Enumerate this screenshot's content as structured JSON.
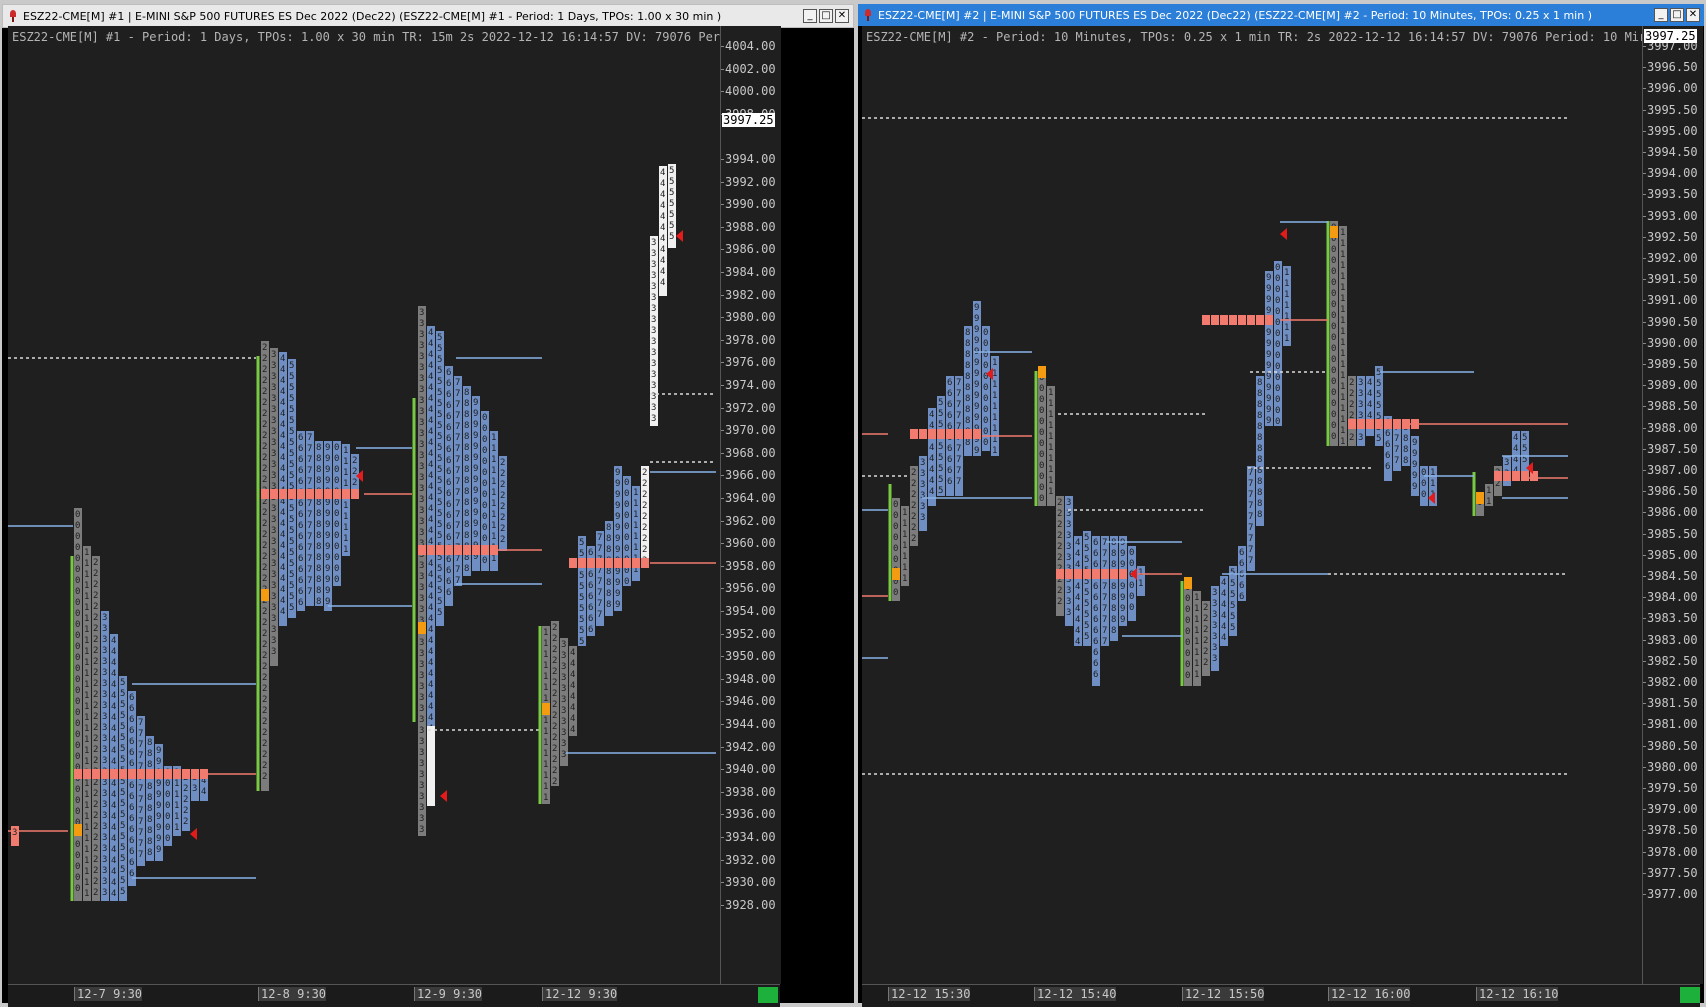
{
  "window1": {
    "title": "ESZ22-CME[M]  #1 |  E-MINI S&P 500 FUTURES ES Dec 2022 (Dec22) (ESZ22-CME[M]  #1 - Period: 1 Days, TPOs: 1.00 x 30 min  )",
    "header": "ESZ22-CME[M]  #1 - Period: 1 Days, TPOs: 1.00 x 30 min    TR: 15m 2s 2022-12-12 16:14:57 DV: 79076 Period: 1 Day",
    "current_price": "3997.25",
    "y_ticks": [
      "4004.00",
      "4002.00",
      "4000.00",
      "3998.00",
      "3994.00",
      "3992.00",
      "3990.00",
      "3988.00",
      "3986.00",
      "3984.00",
      "3982.00",
      "3980.00",
      "3978.00",
      "3976.00",
      "3974.00",
      "3972.00",
      "3970.00",
      "3968.00",
      "3966.00",
      "3964.00",
      "3962.00",
      "3960.00",
      "3958.00",
      "3956.00",
      "3954.00",
      "3952.00",
      "3950.00",
      "3948.00",
      "3946.00",
      "3944.00",
      "3942.00",
      "3940.00",
      "3938.00",
      "3936.00",
      "3934.00",
      "3932.00",
      "3930.00",
      "3928.00"
    ],
    "x_ticks": [
      "12-7  9:30",
      "12-8  9:30",
      "12-9  9:30",
      "12-12  9:30"
    ]
  },
  "window2": {
    "title": "ESZ22-CME[M]  #2 |  E-MINI S&P 500 FUTURES ES Dec 2022 (Dec22) (ESZ22-CME[M]  #2 - Period: 10 Minutes, TPOs: 0.25 x 1 min  )",
    "header": "ESZ22-CME[M]  #2 - Period: 10 Minutes, TPOs: 0.25 x 1 min    TR: 2s 2022-12-12 16:14:57 DV: 79076 Period: 10 Mir",
    "current_price": "3997.25",
    "y_ticks": [
      "3997.00",
      "3996.50",
      "3996.00",
      "3995.50",
      "3995.00",
      "3994.50",
      "3994.00",
      "3993.50",
      "3993.00",
      "3992.50",
      "3992.00",
      "3991.50",
      "3991.00",
      "3990.50",
      "3990.00",
      "3989.50",
      "3989.00",
      "3988.50",
      "3988.00",
      "3987.50",
      "3987.00",
      "3986.50",
      "3986.00",
      "3985.50",
      "3985.00",
      "3984.50",
      "3984.00",
      "3983.50",
      "3983.00",
      "3982.50",
      "3982.00",
      "3981.50",
      "3981.00",
      "3980.50",
      "3980.00",
      "3979.50",
      "3979.00",
      "3978.50",
      "3978.00",
      "3977.50",
      "3977.00"
    ],
    "x_ticks": [
      "12-12  15:30",
      "12-12  15:40",
      "12-12  15:50",
      "12-12  16:00",
      "12-12  16:10"
    ]
  },
  "window_buttons": {
    "minimize": "_",
    "maximize": "□",
    "close": "✕"
  },
  "colors": {
    "background": "#1f1f1f",
    "tpo_gray": "#7c7c7c",
    "tpo_blue": "#6f8fc4",
    "tpo_white": "#f0f0f0",
    "poc_red": "#f07b6e",
    "initial_balance": "#7ac943",
    "open_marker": "#f39c12",
    "value_line": "#8ab4e8",
    "close_arrow": "#e31b1b"
  }
}
